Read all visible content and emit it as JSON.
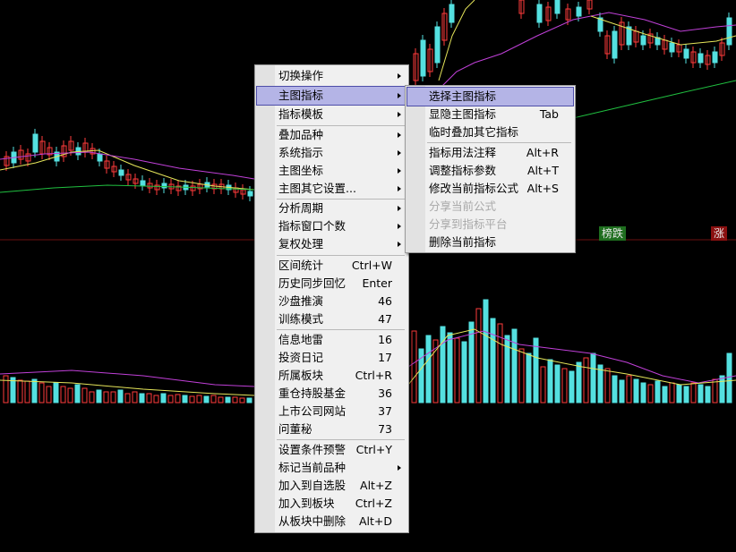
{
  "chart_tags": {
    "left": "榜跌",
    "right": "涨"
  },
  "colors": {
    "up": "#ff3b3b",
    "down": "#54e0e0",
    "ma_yellow": "#e6e65a",
    "ma_magenta": "#c040d8",
    "ma_green": "#20c040",
    "highlight": "#b4b4e6"
  },
  "main_menu": {
    "items": [
      {
        "label": "切换操作",
        "submenu": true
      },
      {
        "label": "主图指标",
        "submenu": true,
        "highlighted": true
      },
      {
        "label": "指标模板",
        "submenu": true
      },
      {
        "label": "叠加品种",
        "submenu": true
      },
      {
        "label": "系统指示",
        "submenu": true
      },
      {
        "label": "主图坐标",
        "submenu": true
      },
      {
        "label": "主图其它设置...",
        "submenu": true
      },
      {
        "label": "分析周期",
        "submenu": true
      },
      {
        "label": "指标窗口个数",
        "submenu": true
      },
      {
        "label": "复权处理",
        "submenu": true
      },
      {
        "label": "区间统计",
        "shortcut": "Ctrl+W"
      },
      {
        "label": "历史同步回忆",
        "shortcut": "Enter"
      },
      {
        "label": "沙盘推演",
        "shortcut": "46"
      },
      {
        "label": "训练模式",
        "shortcut": "47"
      },
      {
        "label": "信息地雷",
        "shortcut": "16"
      },
      {
        "label": "投资日记",
        "shortcut": "17"
      },
      {
        "label": "所属板块",
        "shortcut": "Ctrl+R"
      },
      {
        "label": "重仓持股基金",
        "shortcut": "36"
      },
      {
        "label": "上市公司网站",
        "shortcut": "37"
      },
      {
        "label": "问董秘",
        "shortcut": "73"
      },
      {
        "label": "设置条件预警",
        "shortcut": "Ctrl+Y"
      },
      {
        "label": "标记当前品种",
        "submenu": true
      },
      {
        "label": "加入到自选股",
        "shortcut": "Alt+Z"
      },
      {
        "label": "加入到板块",
        "shortcut": "Ctrl+Z"
      },
      {
        "label": "从板块中删除",
        "shortcut": "Alt+D"
      }
    ]
  },
  "sub_menu": {
    "items": [
      {
        "label": "选择主图指标",
        "highlighted": true
      },
      {
        "label": "显隐主图指标",
        "shortcut": "Tab"
      },
      {
        "label": "临时叠加其它指标"
      },
      {
        "label": "指标用法注释",
        "shortcut": "Alt+R"
      },
      {
        "label": "调整指标参数",
        "shortcut": "Alt+T"
      },
      {
        "label": "修改当前指标公式",
        "shortcut": "Alt+S"
      },
      {
        "label": "分享当前公式",
        "disabled": true
      },
      {
        "label": "分享到指标平台",
        "disabled": true
      },
      {
        "label": "删除当前指标"
      }
    ]
  }
}
